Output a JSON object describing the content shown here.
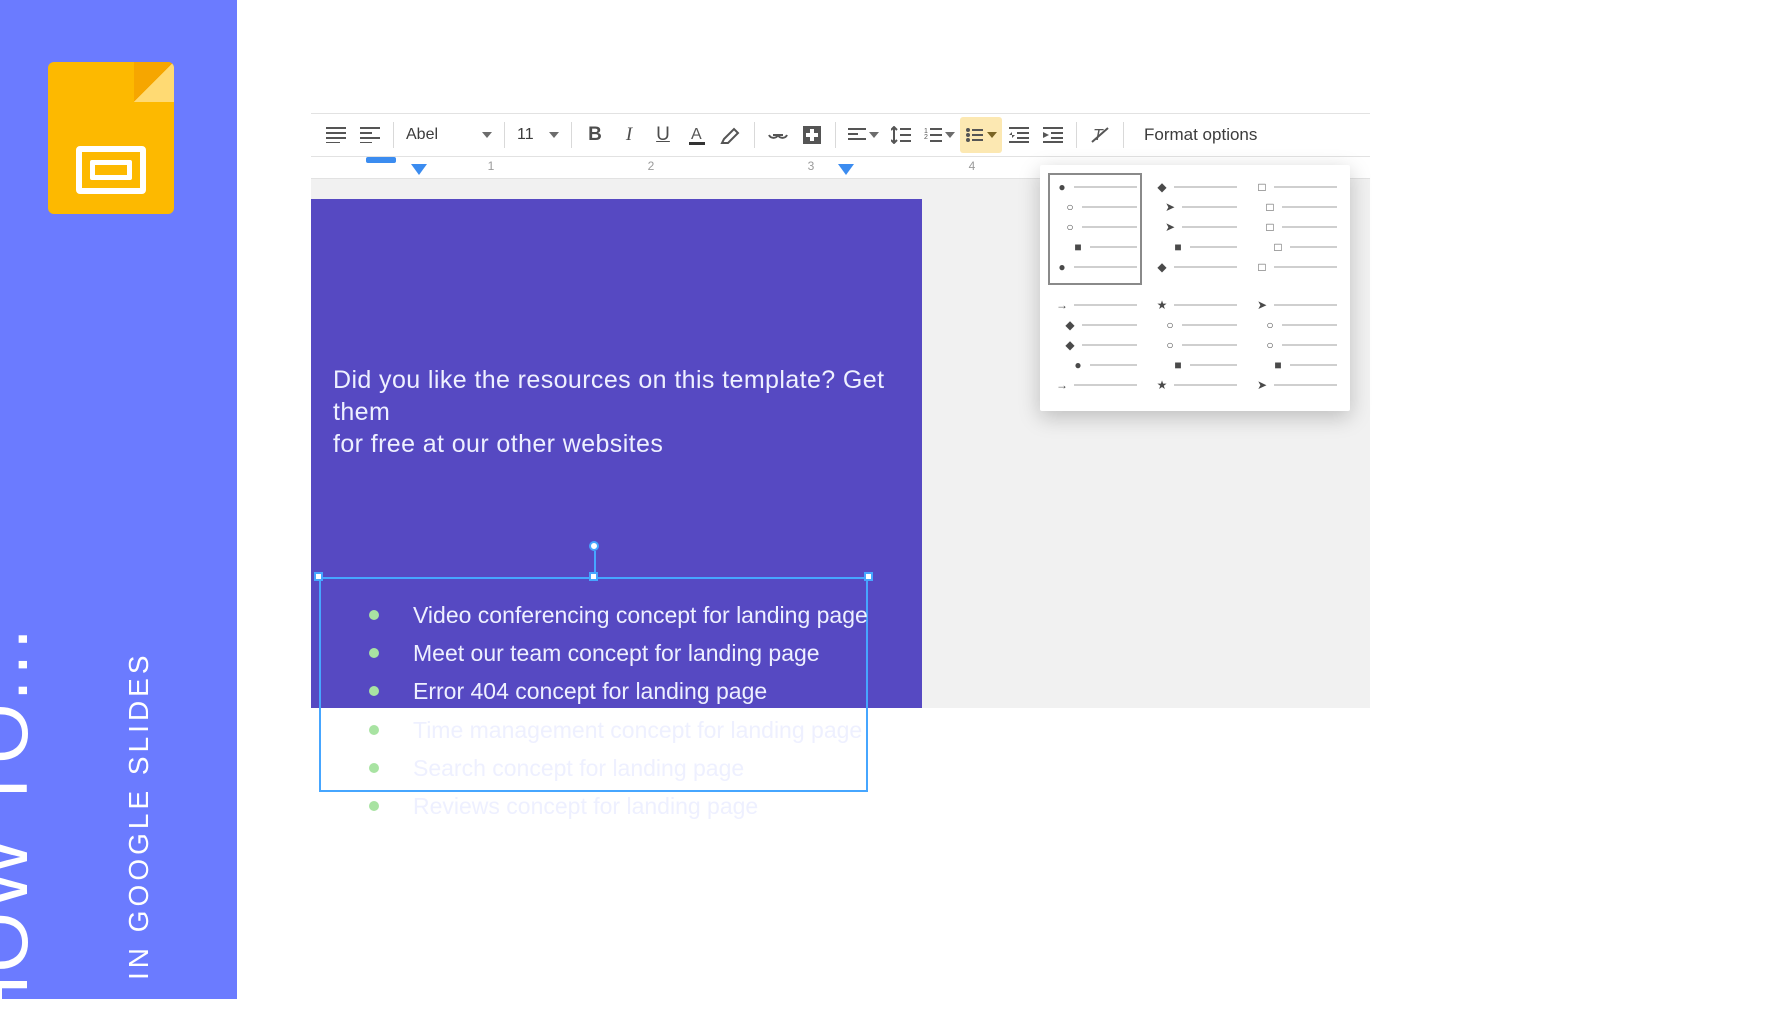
{
  "panel": {
    "howto": "HOW TO",
    "dots": "...",
    "sub": "IN GOOGLE SLIDES"
  },
  "toolbar": {
    "font_name": "Abel",
    "font_size": "11",
    "format_options": "Format options"
  },
  "ruler": {
    "marks": [
      "1",
      "2",
      "3",
      "4"
    ]
  },
  "slide": {
    "heading_line1": "Did you like the resources on this template? Get them",
    "heading_line2": "for free at our other websites",
    "bullets": [
      "Video conferencing concept for landing page",
      "Meet our team concept for landing page",
      "Error 404 concept for landing page",
      "Time management concept for landing page",
      "Search concept for landing page",
      "Reviews concept for landing page"
    ]
  },
  "bullet_presets": [
    {
      "glyphs": [
        "●",
        "○",
        "○",
        "■",
        "●"
      ],
      "indents": [
        0,
        1,
        1,
        2,
        0
      ],
      "selected": true
    },
    {
      "glyphs": [
        "◆",
        "➤",
        "➤",
        "■",
        "◆"
      ],
      "indents": [
        0,
        1,
        1,
        2,
        0
      ]
    },
    {
      "glyphs": [
        "□",
        "□",
        "□",
        "□",
        "□"
      ],
      "indents": [
        0,
        1,
        1,
        2,
        0
      ]
    },
    {
      "glyphs": [
        "→",
        "◆",
        "◆",
        "●",
        "→"
      ],
      "indents": [
        0,
        1,
        1,
        2,
        0
      ]
    },
    {
      "glyphs": [
        "★",
        "○",
        "○",
        "■",
        "★"
      ],
      "indents": [
        0,
        1,
        1,
        2,
        0
      ]
    },
    {
      "glyphs": [
        "➤",
        "○",
        "○",
        "■",
        "➤"
      ],
      "indents": [
        0,
        1,
        1,
        2,
        0
      ]
    }
  ]
}
